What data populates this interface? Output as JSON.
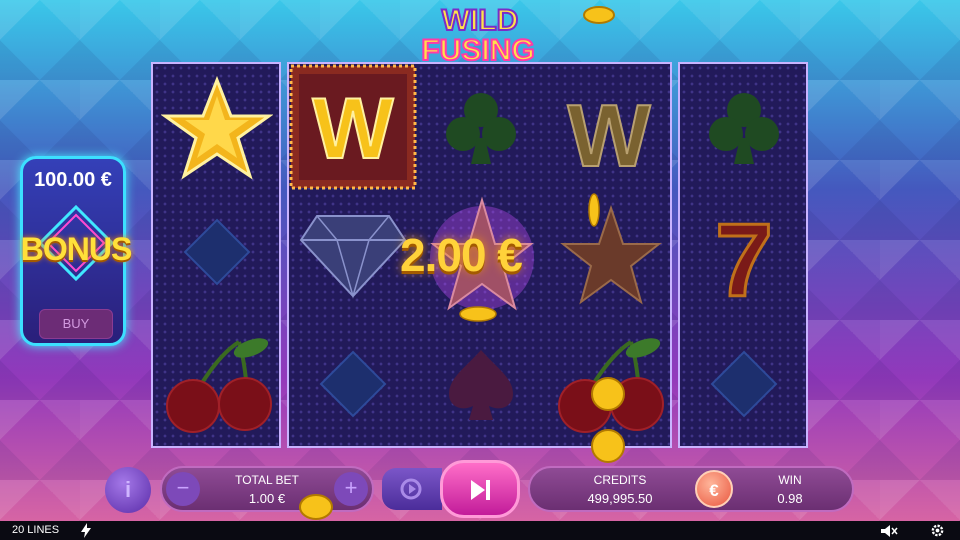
{
  "game": {
    "logo_line1": "WILD",
    "logo_line2": "FUSING"
  },
  "bonus": {
    "amount": "100.00 €",
    "label": "BONUS",
    "buy_label": "BUY"
  },
  "reels": {
    "reel1": [
      "star",
      "diamond-suit",
      "cherries"
    ],
    "reel2": [
      [
        "wild",
        "diamond-gem",
        "diamond-suit"
      ],
      [
        "club",
        "star",
        "spade"
      ],
      [
        "wild",
        "star",
        "cherries"
      ]
    ],
    "reel3": [
      "club",
      "seven",
      "diamond-suit"
    ],
    "wild_letter": "W",
    "seven_glyph": "7"
  },
  "win_display": "2.00 €",
  "controls": {
    "info_label": "i",
    "total_bet_label": "TOTAL BET",
    "total_bet_value": "1.00 €",
    "minus_label": "−",
    "plus_label": "+",
    "credits_label": "CREDITS",
    "credits_value": "499,995.50",
    "currency_symbol": "€",
    "win_label": "WIN",
    "win_value": "0.98"
  },
  "status_bar": {
    "lines": "20 LINES"
  },
  "colors": {
    "accent_gold": "#ffd23a",
    "spin_pink": "#e02cab",
    "panel_cyan": "#3ce0ff"
  }
}
